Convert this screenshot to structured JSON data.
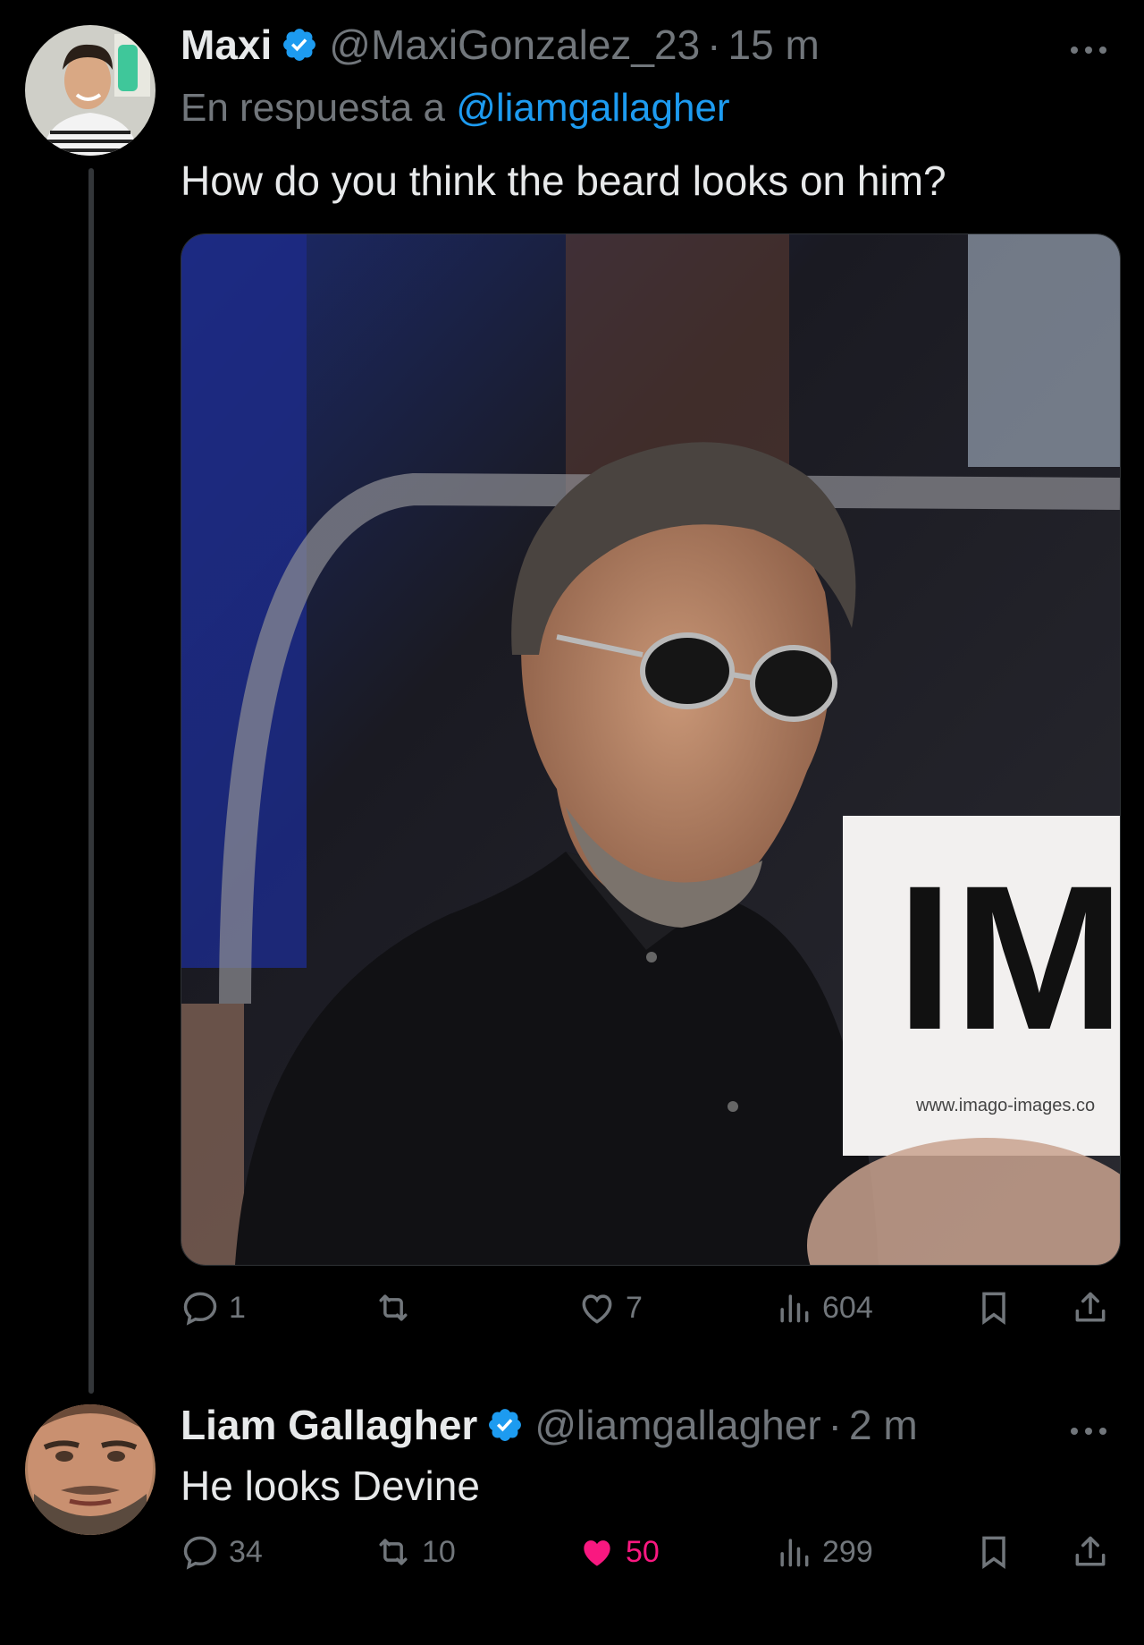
{
  "tweet1": {
    "name": "Maxi",
    "handle": "@MaxiGonzalez_23",
    "separator": "·",
    "time": "15 m",
    "reply_prefix": "En respuesta a ",
    "reply_mention": "@liamgallagher",
    "text": "How do you think the beard looks on him?",
    "media": {
      "watermark_text": "IMA",
      "watermark_url": "www.imago-images.co"
    },
    "actions": {
      "replies": "1",
      "retweets": "",
      "likes": "7",
      "views": "604"
    },
    "more_icon": "more-horizontal-icon"
  },
  "tweet2": {
    "name": "Liam Gallagher",
    "handle": "@liamgallagher",
    "separator": "·",
    "time": "2 m",
    "text": "He looks Devine",
    "actions": {
      "replies": "34",
      "retweets": "10",
      "likes": "50",
      "views": "299"
    },
    "liked": true
  },
  "colors": {
    "background": "#000000",
    "text": "#e7e9ea",
    "secondary": "#71767b",
    "link": "#1d9bf0",
    "like_active": "#f91880",
    "verified": "#1d9bf0"
  }
}
